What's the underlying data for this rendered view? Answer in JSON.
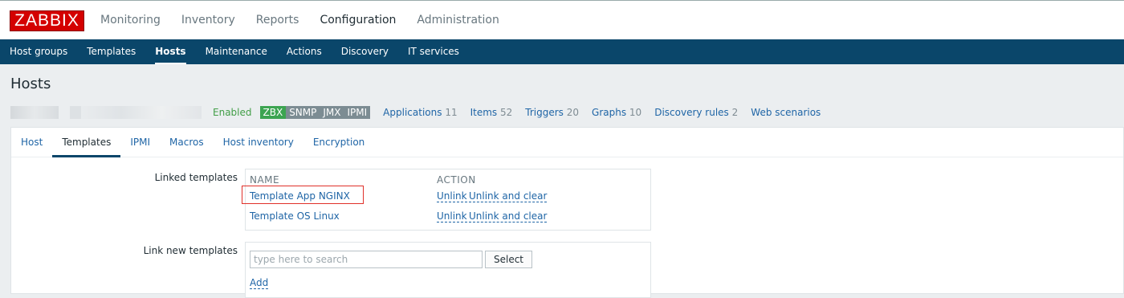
{
  "logo": "ZABBIX",
  "main_menu": [
    "Monitoring",
    "Inventory",
    "Reports",
    "Configuration",
    "Administration"
  ],
  "sub_menu": [
    "Host groups",
    "Templates",
    "Hosts",
    "Maintenance",
    "Actions",
    "Discovery",
    "IT services"
  ],
  "page_title": "Hosts",
  "status": {
    "enabled": "Enabled",
    "badges": [
      "ZBX",
      "SNMP",
      "JMX",
      "IPMI"
    ],
    "links": [
      {
        "label": "Applications",
        "count": "11"
      },
      {
        "label": "Items",
        "count": "52"
      },
      {
        "label": "Triggers",
        "count": "20"
      },
      {
        "label": "Graphs",
        "count": "10"
      },
      {
        "label": "Discovery rules",
        "count": "2"
      },
      {
        "label": "Web scenarios",
        "count": ""
      }
    ]
  },
  "tabs": [
    "Host",
    "Templates",
    "IPMI",
    "Macros",
    "Host inventory",
    "Encryption"
  ],
  "linked_templates": {
    "label": "Linked templates",
    "col_name": "NAME",
    "col_action": "ACTION",
    "rows": [
      {
        "name": "Template App NGINX",
        "unlink": "Unlink",
        "unlink_clear": "Unlink and clear"
      },
      {
        "name": "Template OS Linux",
        "unlink": "Unlink",
        "unlink_clear": "Unlink and clear"
      }
    ]
  },
  "link_new": {
    "label": "Link new templates",
    "placeholder": "type here to search",
    "select": "Select",
    "add": "Add"
  },
  "colors": {
    "header": "#0a466a",
    "logo": "#d40000",
    "link": "#1f65a6",
    "enabled": "#429e47",
    "highlight": "#e0302a"
  }
}
